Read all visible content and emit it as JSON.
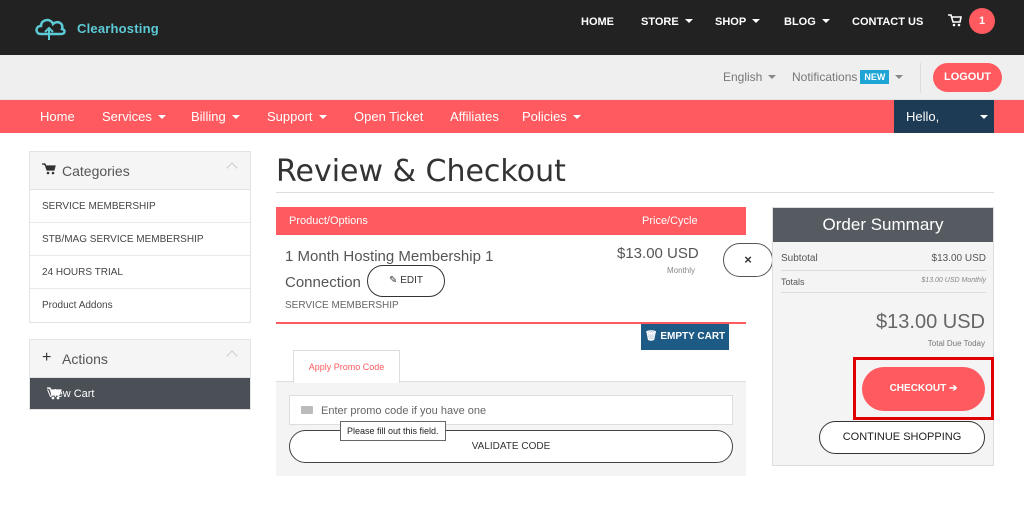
{
  "brand": {
    "name": "Clearhosting",
    "accent": "#ff5a5f",
    "dark": "#222222",
    "logo_color": "#5dcbd6"
  },
  "topnav": {
    "items": [
      "HOME",
      "STORE",
      "SHOP",
      "BLOG",
      "CONTACT US"
    ],
    "cart_count": "1"
  },
  "utilbar": {
    "language": "English",
    "notifications": "Notifications",
    "new_badge": "NEW",
    "logout": "LOGOUT"
  },
  "mainnav": {
    "items": [
      "Home",
      "Services",
      "Billing",
      "Support",
      "Open Ticket",
      "Affiliates",
      "Policies"
    ],
    "hello": "Hello,"
  },
  "sidebar": {
    "categories_title": "Categories",
    "categories": [
      "SERVICE MEMBERSHIP",
      "STB/MAG SERVICE MEMBERSHIP",
      "24 HOURS TRIAL",
      "Product Addons"
    ],
    "actions_title": "Actions",
    "view_cart": "View Cart"
  },
  "main": {
    "title": "Review & Checkout",
    "table": {
      "col_product": "Product/Options",
      "col_price": "Price/Cycle"
    },
    "item": {
      "name": "1 Month Hosting Membership 1 Connection",
      "edit": "EDIT",
      "group": "SERVICE MEMBERSHIP",
      "price": "$13.00 USD",
      "cycle": "Monthly",
      "remove": "×"
    },
    "empty_cart": "EMPTY CART",
    "promo": {
      "tab": "Apply Promo Code",
      "placeholder": "Enter promo code if you have one",
      "tooltip": "Please fill out this field.",
      "validate": "VALIDATE CODE"
    }
  },
  "summary": {
    "title": "Order Summary",
    "subtotal_label": "Subtotal",
    "subtotal_value": "$13.00 USD",
    "totals_label": "Totals",
    "totals_value": "$13.00 USD Monthly",
    "total": "$13.00 USD",
    "total_label": "Total Due Today",
    "checkout": "CHECKOUT",
    "continue": "CONTINUE SHOPPING"
  }
}
